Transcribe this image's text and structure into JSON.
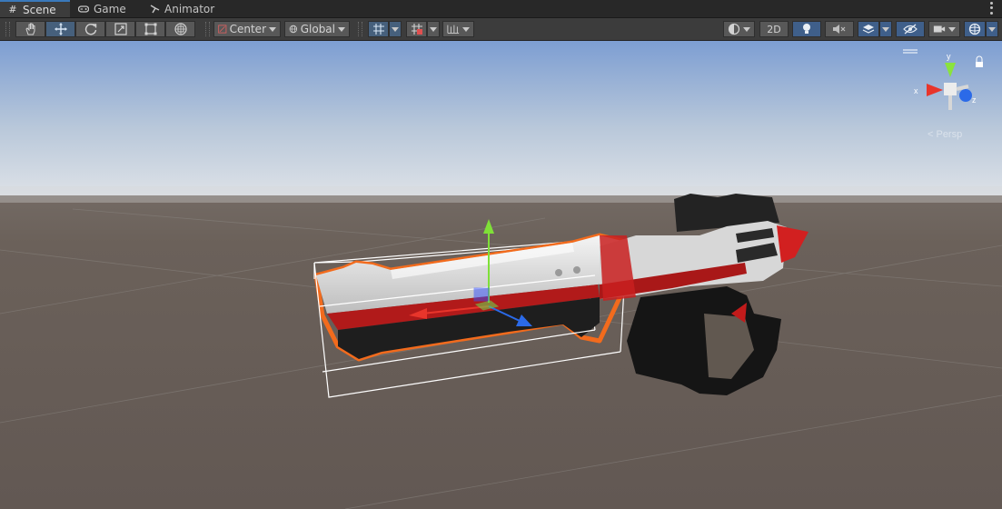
{
  "tabs": [
    {
      "label": "Scene",
      "icon": "grid-icon",
      "active": true
    },
    {
      "label": "Game",
      "icon": "gamepad-icon",
      "active": false
    },
    {
      "label": "Animator",
      "icon": "animator-icon",
      "active": false
    }
  ],
  "toolbar": {
    "tools": [
      "hand-tool",
      "move-tool",
      "rotate-tool",
      "scale-tool",
      "rect-tool",
      "transform-tool"
    ],
    "pivot_label": "Center",
    "space_label": "Global",
    "mode_2d_label": "2D"
  },
  "gizmo": {
    "x_label": "x",
    "y_label": "y",
    "z_label": "z",
    "projection_label": "< Persp"
  },
  "colors": {
    "accent": "#3a79bb",
    "selection_outline": "#f26b1d",
    "x_axis": "#e8352b",
    "y_axis": "#7fe038",
    "z_axis": "#2b6ae8"
  }
}
